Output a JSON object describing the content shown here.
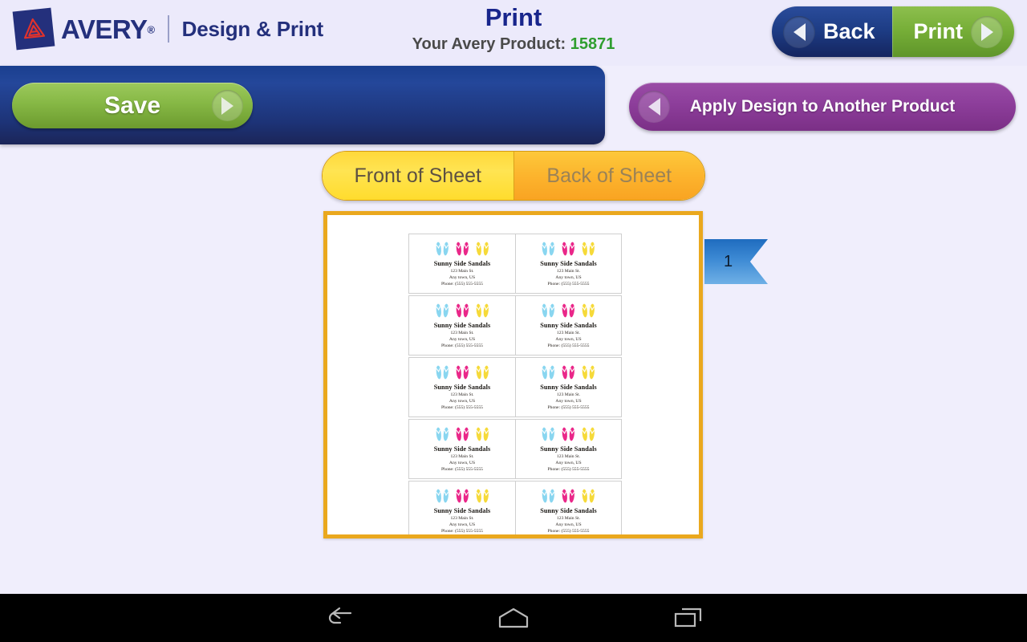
{
  "app": {
    "brand_name": "AVERY",
    "brand_reg": "®",
    "brand_subtitle": "Design & Print"
  },
  "header": {
    "title": "Print",
    "product_prefix": "Your Avery Product:",
    "product_code": "15871",
    "back_label": "Back",
    "print_label": "Print",
    "back_icon": "triangle-left-icon",
    "print_icon": "triangle-right-icon"
  },
  "actions": {
    "save_label": "Save",
    "save_icon": "triangle-right-icon",
    "apply_label": "Apply Design to Another Product",
    "apply_icon": "triangle-left-icon"
  },
  "tabs": [
    {
      "label": "Front of Sheet",
      "selected": true
    },
    {
      "label": "Back of Sheet",
      "selected": false
    }
  ],
  "preview": {
    "page_number": "1",
    "columns": 2,
    "rows": 5,
    "label": {
      "business_name": "Sunny Side Sandals",
      "address_line1": "123 Main St.",
      "address_line2": "Any town, US",
      "phone": "Phone: (555) 555-5555",
      "art_icon": "flip-flops-icon",
      "art_colors": [
        "#7fd2ef",
        "#e8157f",
        "#f5d728"
      ]
    }
  },
  "navbar": {
    "back": "back-arrow-icon",
    "home": "home-icon",
    "recent": "recent-apps-icon"
  },
  "colors": {
    "page_background": "#f0eefc",
    "brand_navy": "#24307c",
    "title_blue": "#18258c",
    "product_green": "#2f9e2f",
    "save_green": "#86b845",
    "apply_purple": "#8e3f9c",
    "sheet_border_gold": "#eaa81e",
    "tab_yellow": "#ffe452",
    "tab_orange": "#fcb22c",
    "ribbon_blue": "#3d8ad4"
  }
}
